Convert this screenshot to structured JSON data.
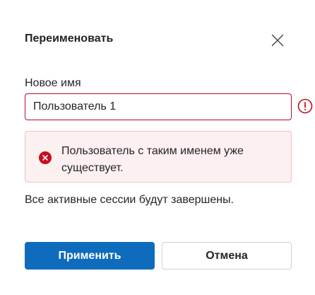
{
  "dialog": {
    "title": "Переименовать",
    "close_icon": "close-icon"
  },
  "form": {
    "label": "Новое имя",
    "value": "Пользователь 1",
    "error_indicator_icon": "error-circle-icon"
  },
  "error": {
    "icon": "error-dismiss-icon",
    "message": "Пользователь с таким именем уже существует."
  },
  "info": {
    "text": "Все активные сессии будут завершены."
  },
  "actions": {
    "apply_label": "Применить",
    "cancel_label": "Отмена"
  },
  "colors": {
    "primary": "#0f6cbd",
    "error": "#c50f1f",
    "error_background": "#fdf0f1"
  }
}
